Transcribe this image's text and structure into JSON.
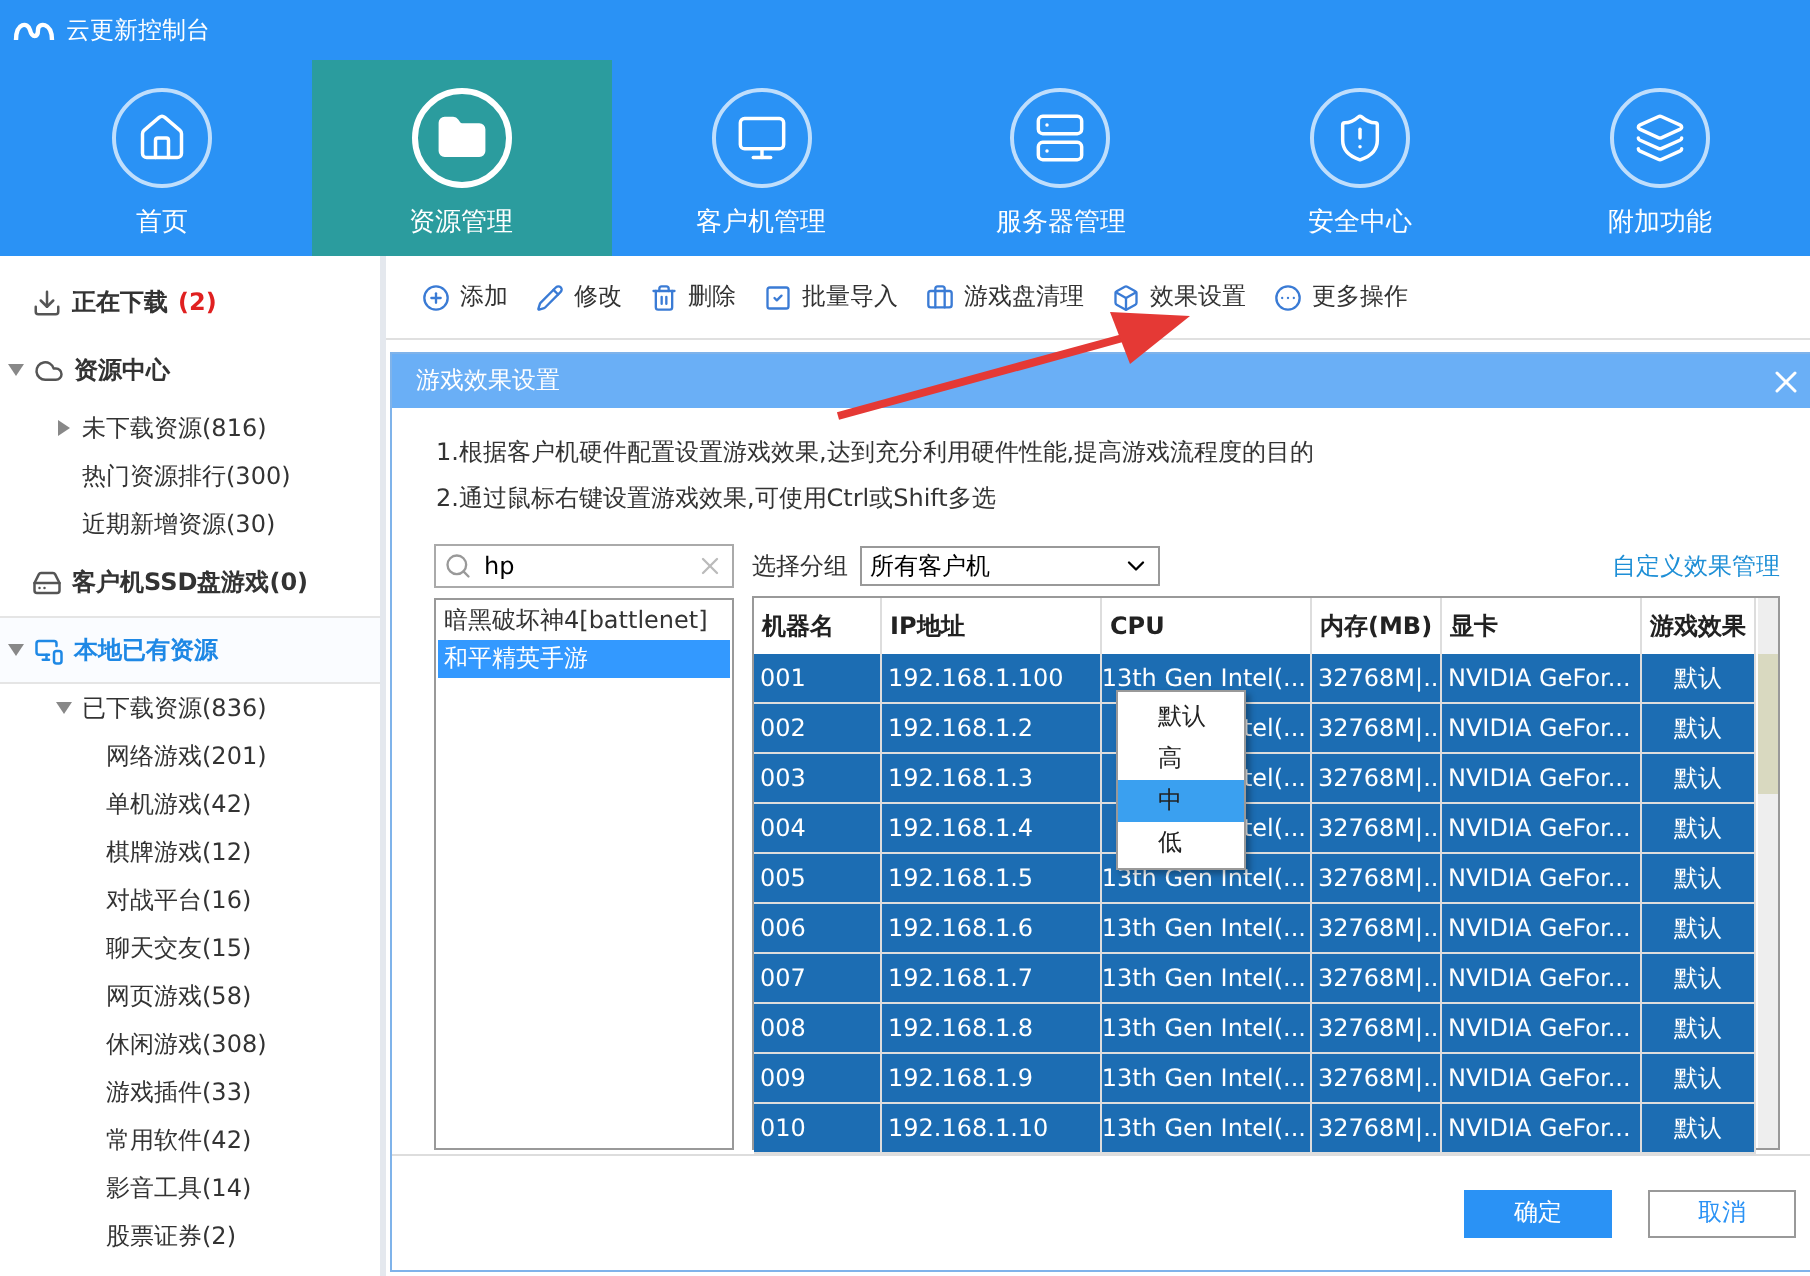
{
  "app": {
    "title": "云更新控制台"
  },
  "nav": [
    {
      "label": "首页",
      "selected": false
    },
    {
      "label": "资源管理",
      "selected": true
    },
    {
      "label": "客户机管理",
      "selected": false
    },
    {
      "label": "服务器管理",
      "selected": false
    },
    {
      "label": "安全中心",
      "selected": false
    },
    {
      "label": "附加功能",
      "selected": false
    }
  ],
  "sidebar": {
    "items": [
      {
        "kind": "download",
        "label": "正在下载",
        "count": "(2)"
      },
      {
        "kind": "section",
        "label": "资源中心",
        "expanded": true,
        "selected": false,
        "children": [
          {
            "label": "未下载资源(816)",
            "expanded": false
          },
          {
            "label": "热门资源排行(300)"
          },
          {
            "label": "近期新增资源(30)"
          }
        ]
      },
      {
        "kind": "ssd",
        "label": "客户机SSD盘游戏(0)"
      },
      {
        "kind": "section",
        "label": "本地已有资源",
        "expanded": true,
        "selected": true,
        "children": [
          {
            "label": "已下载资源(836)",
            "expanded": true,
            "children": [
              {
                "label": "网络游戏(201)"
              },
              {
                "label": "单机游戏(42)"
              },
              {
                "label": "棋牌游戏(12)"
              },
              {
                "label": "对战平台(16)"
              },
              {
                "label": "聊天交友(15)"
              },
              {
                "label": "网页游戏(58)"
              },
              {
                "label": "休闲游戏(308)"
              },
              {
                "label": "游戏插件(33)"
              },
              {
                "label": "常用软件(42)"
              },
              {
                "label": "影音工具(14)"
              },
              {
                "label": "股票证券(2)"
              }
            ]
          }
        ]
      }
    ]
  },
  "toolbar": [
    {
      "label": "添加"
    },
    {
      "label": "修改"
    },
    {
      "label": "删除"
    },
    {
      "label": "批量导入"
    },
    {
      "label": "游戏盘清理"
    },
    {
      "label": "效果设置"
    },
    {
      "label": "更多操作"
    }
  ],
  "dialog": {
    "title": "游戏效果设置",
    "notes": [
      "1.根据客户机硬件配置设置游戏效果,达到充分利用硬件性能,提高游戏流程度的目的",
      "2.通过鼠标右键设置游戏效果,可使用Ctrl或Shift多选"
    ],
    "search": {
      "value": "hp"
    },
    "games": [
      {
        "label": "暗黑破坏神4[battlenet]",
        "selected": false
      },
      {
        "label": "和平精英手游",
        "selected": true
      }
    ],
    "group_label": "选择分组",
    "group_value": "所有客户机",
    "link": "自定义效果管理",
    "table": {
      "columns": [
        "机器名",
        "IP地址",
        "CPU",
        "内存(MB)",
        "显卡",
        "游戏效果"
      ],
      "rows": [
        {
          "cells": [
            "001",
            "192.168.1.100",
            "13th Gen Intel(...",
            "32768M|...",
            "NVIDIA GeFor...",
            "默认"
          ],
          "selected": true
        },
        {
          "cells": [
            "002",
            "192.168.1.2",
            "tel(...",
            "32768M|...",
            "NVIDIA GeFor...",
            "默认"
          ],
          "selected": true
        },
        {
          "cells": [
            "003",
            "192.168.1.3",
            "tel(...",
            "32768M|...",
            "NVIDIA GeFor...",
            "默认"
          ],
          "selected": true
        },
        {
          "cells": [
            "004",
            "192.168.1.4",
            "tel(...",
            "32768M|...",
            "NVIDIA GeFor...",
            "默认"
          ],
          "selected": true
        },
        {
          "cells": [
            "005",
            "192.168.1.5",
            "13th Gen Intel(...",
            "32768M|...",
            "NVIDIA GeFor...",
            "默认"
          ],
          "selected": true
        },
        {
          "cells": [
            "006",
            "192.168.1.6",
            "13th Gen Intel(...",
            "32768M|...",
            "NVIDIA GeFor...",
            "默认"
          ],
          "selected": true
        },
        {
          "cells": [
            "007",
            "192.168.1.7",
            "13th Gen Intel(...",
            "32768M|...",
            "NVIDIA GeFor...",
            "默认"
          ],
          "selected": true
        },
        {
          "cells": [
            "008",
            "192.168.1.8",
            "13th Gen Intel(...",
            "32768M|...",
            "NVIDIA GeFor...",
            "默认"
          ],
          "selected": true
        },
        {
          "cells": [
            "009",
            "192.168.1.9",
            "13th Gen Intel(...",
            "32768M|...",
            "NVIDIA GeFor...",
            "默认"
          ],
          "selected": true
        },
        {
          "cells": [
            "010",
            "192.168.1.10",
            "13th Gen Intel(...",
            "32768M|...",
            "NVIDIA GeFor...",
            "默认"
          ],
          "selected": true
        }
      ]
    },
    "context_menu": [
      {
        "label": "默认",
        "selected": false
      },
      {
        "label": "高",
        "selected": false
      },
      {
        "label": "中",
        "selected": true
      },
      {
        "label": "低",
        "selected": false
      }
    ],
    "buttons": [
      {
        "label": "确定",
        "kind": "primary"
      },
      {
        "label": "取消",
        "kind": "secondary"
      }
    ]
  }
}
